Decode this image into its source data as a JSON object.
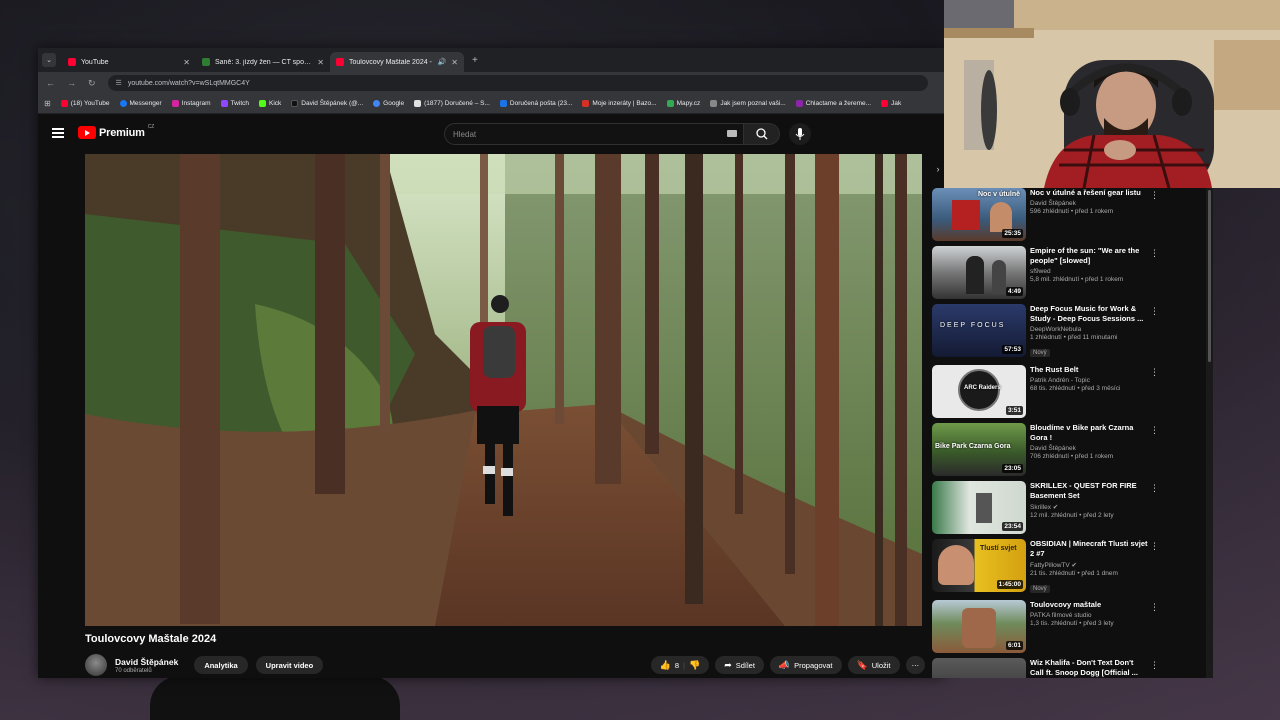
{
  "browser": {
    "tabs": [
      {
        "title": "YouTube",
        "favicon_color": "#ff0033",
        "active": false
      },
      {
        "title": "Saně: 3. jízdy žen — ČT sport —",
        "favicon_color": "#2e7d32",
        "active": false
      },
      {
        "title": "Toulovcovy Maštale 2024 -",
        "favicon_color": "#ff0033",
        "active": true
      }
    ],
    "url": "youtube.com/watch?v=wSLqtMMGC4Y",
    "bookmarks": [
      {
        "label": "(18) YouTube",
        "color": "#ff0033"
      },
      {
        "label": "Messenger",
        "color": "#1877f2"
      },
      {
        "label": "Instagram",
        "color": "#d6249f"
      },
      {
        "label": "Twitch",
        "color": "#9146ff"
      },
      {
        "label": "Kick",
        "color": "#53fc18"
      },
      {
        "label": "David Štěpánek (@...",
        "color": "#111111"
      },
      {
        "label": "Google",
        "color": "#4285f4"
      },
      {
        "label": "(1877) Doručené – S...",
        "color": "#e0e0e0"
      },
      {
        "label": "Doručená pošta (23...",
        "color": "#1a73e8"
      },
      {
        "label": "Moje inzeráty | Bazo...",
        "color": "#d93025"
      },
      {
        "label": "Mapy.cz",
        "color": "#34a853"
      },
      {
        "label": "Jak jsem poznal vaši...",
        "color": "#888888"
      },
      {
        "label": "Chlactame a žereme...",
        "color": "#8e24aa"
      },
      {
        "label": "Jak",
        "color": "#ff0033"
      }
    ]
  },
  "youtube": {
    "logo_text": "Premium",
    "country_code": "CZ",
    "search_placeholder": "Hledat",
    "video": {
      "title": "Toulovcovy Maštale 2024",
      "channel": "David Štěpánek",
      "subscribers": "70 odběratelů",
      "analytics_label": "Analytika",
      "edit_label": "Upravit video",
      "likes": "8",
      "share_label": "Sdílet",
      "promote_label": "Propagovat",
      "save_label": "Uložit"
    },
    "recommendations": [
      {
        "title": "Noc v útulné a řešení gear listu",
        "channel": "David Štěpánek",
        "views": "596 zhlédnutí • před 1 rokem",
        "duration": "25:35",
        "thumb_text": "Noc v útulně",
        "badge": "",
        "verified": false
      },
      {
        "title": "Empire of the sun: \"We are the people\" [slowed]",
        "channel": "sf9wed",
        "views": "5,8 mil. zhlédnutí • před 1 rokem",
        "duration": "4:49",
        "thumb_text": "",
        "badge": "",
        "verified": false
      },
      {
        "title": "Deep Focus Music for Work & Study - Deep Focus Sessions ...",
        "channel": "DeepWorkNebula",
        "views": "1 zhlédnutí • před 11 minutami",
        "duration": "57:53",
        "thumb_text": "DEEP FOCUS",
        "badge": "Nový",
        "verified": false
      },
      {
        "title": "The Rust Belt",
        "channel": "Patrik Andrén - Topic",
        "views": "68 tis. zhlédnutí • před 3 měsíci",
        "duration": "3:51",
        "thumb_text": "ARC Raiders",
        "badge": "",
        "verified": false
      },
      {
        "title": "Bloudíme v Bike park Czarna Gora !",
        "channel": "David Štěpánek",
        "views": "706 zhlédnutí • před 1 rokem",
        "duration": "23:05",
        "thumb_text": "Bike Park Czarna Gora",
        "badge": "",
        "verified": false
      },
      {
        "title": "SKRILLEX - QUEST FOR FIRE Basement Set",
        "channel": "Skrillex",
        "views": "12 mil. zhlédnutí • před 2 lety",
        "duration": "23:54",
        "thumb_text": "",
        "badge": "",
        "verified": true
      },
      {
        "title": "OBSIDIAN | Minecraft Tlusti svjet 2 #7",
        "channel": "FattyPillowTV",
        "views": "21 tis. zhlédnutí • před 1 dnem",
        "duration": "1:45:00",
        "thumb_text": "Tlustí svjet",
        "badge": "Nový",
        "verified": true
      },
      {
        "title": "Toulovcovy maštale",
        "channel": "PATKA filmové studio",
        "views": "1,3 tis. zhlédnutí • před 3 lety",
        "duration": "6:01",
        "thumb_text": "",
        "badge": "",
        "verified": false
      },
      {
        "title": "Wiz Khalifa - Don't Text Don't Call ft. Snoop Dogg [Official ...",
        "channel": "",
        "views": "",
        "duration": "",
        "thumb_text": "",
        "badge": "",
        "verified": false
      }
    ]
  }
}
